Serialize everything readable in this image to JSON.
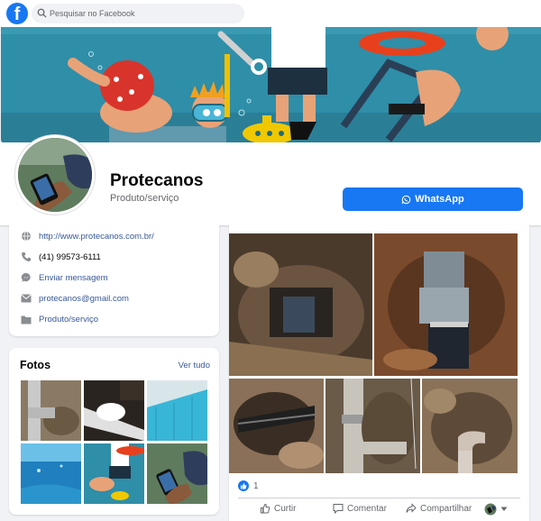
{
  "topbar": {
    "logo": "f",
    "search_placeholder": "Pesquisar no Facebook"
  },
  "profile": {
    "name": "Protecanos",
    "category": "Produto/serviço",
    "whatsapp_label": "WhatsApp"
  },
  "intro": {
    "website": "http://www.protecanos.com.br/",
    "phone": "(41) 99573-6111",
    "message": "Enviar mensagem",
    "email": "protecanos@gmail.com",
    "category": "Produto/serviço"
  },
  "photos": {
    "title": "Fotos",
    "see_all": "Ver tudo"
  },
  "post": {
    "reaction_count": "1",
    "actions": {
      "like": "Curtir",
      "comment": "Comentar",
      "share": "Compartilhar"
    }
  },
  "colors": {
    "accent": "#1877f2",
    "link": "#385898",
    "background": "#f0f2f5",
    "secondary_text": "#65676b"
  },
  "icons": [
    "facebook-logo",
    "search-icon",
    "whatsapp-icon",
    "globe-icon",
    "phone-icon",
    "messenger-icon",
    "mail-icon",
    "category-icon",
    "like-icon",
    "comment-icon",
    "share-icon",
    "chevron-down-icon"
  ]
}
